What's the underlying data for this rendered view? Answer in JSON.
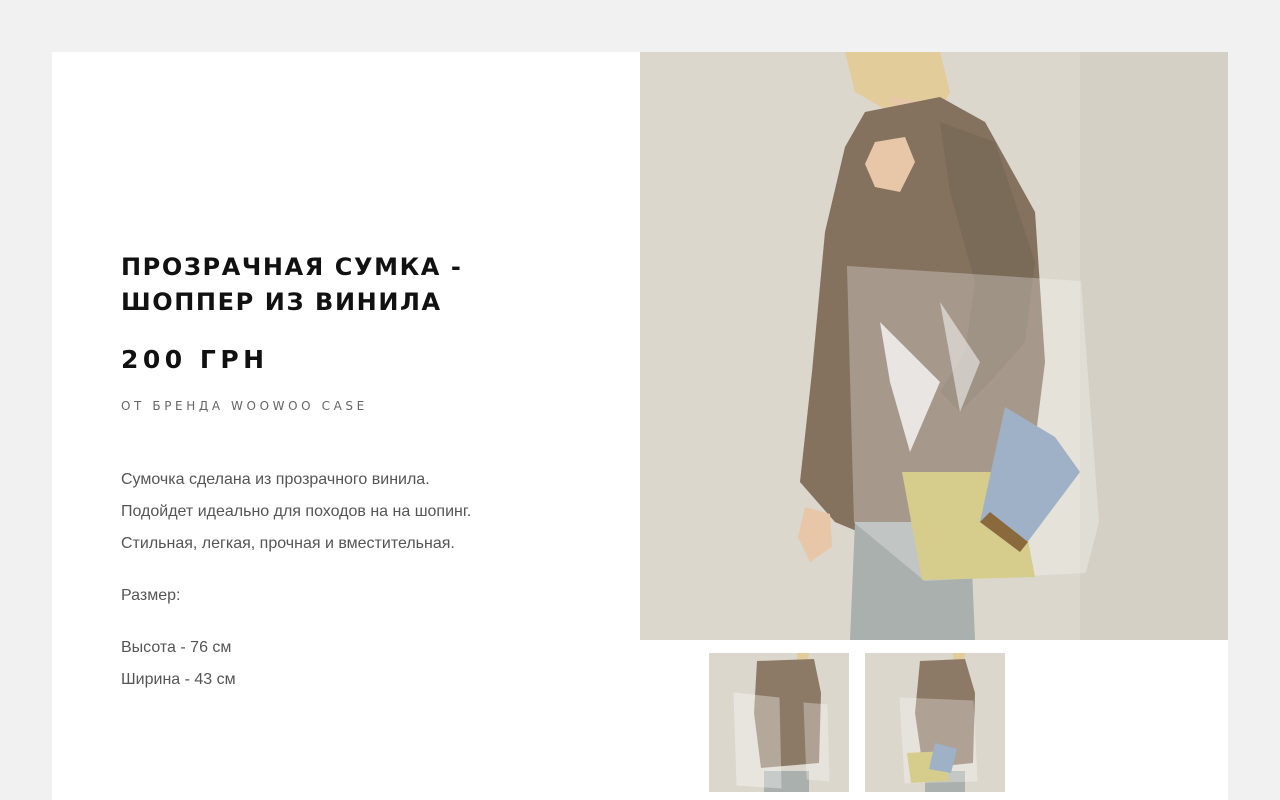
{
  "product": {
    "title": "ПРОЗРАЧНАЯ СУМКА - ШОППЕР ИЗ ВИНИЛА",
    "price": "200 ГРН",
    "brand": "ОТ БРЕНДА WOOWOO CASE",
    "description": [
      "Сумочка сделана из прозрачного винила.",
      "Подойдет идеально для походов на на шопинг.",
      "Стильная, легкая, прочная и вместительная."
    ],
    "size_label": "Размер:",
    "sizes": [
      "Высота - 76 см",
      "Ширина - 43 см"
    ]
  },
  "gallery": {
    "main_photo": "woman-with-transparent-vinyl-shopper-bag-photo",
    "thumbnails": [
      "thumbnail-bag-front",
      "thumbnail-bag-with-wallets"
    ]
  },
  "colors": {
    "page_background": "#f1f1f1",
    "card_background": "#ffffff",
    "photo_background": "#dcd8cd",
    "text_dark": "#111111",
    "text_muted": "#555555"
  }
}
